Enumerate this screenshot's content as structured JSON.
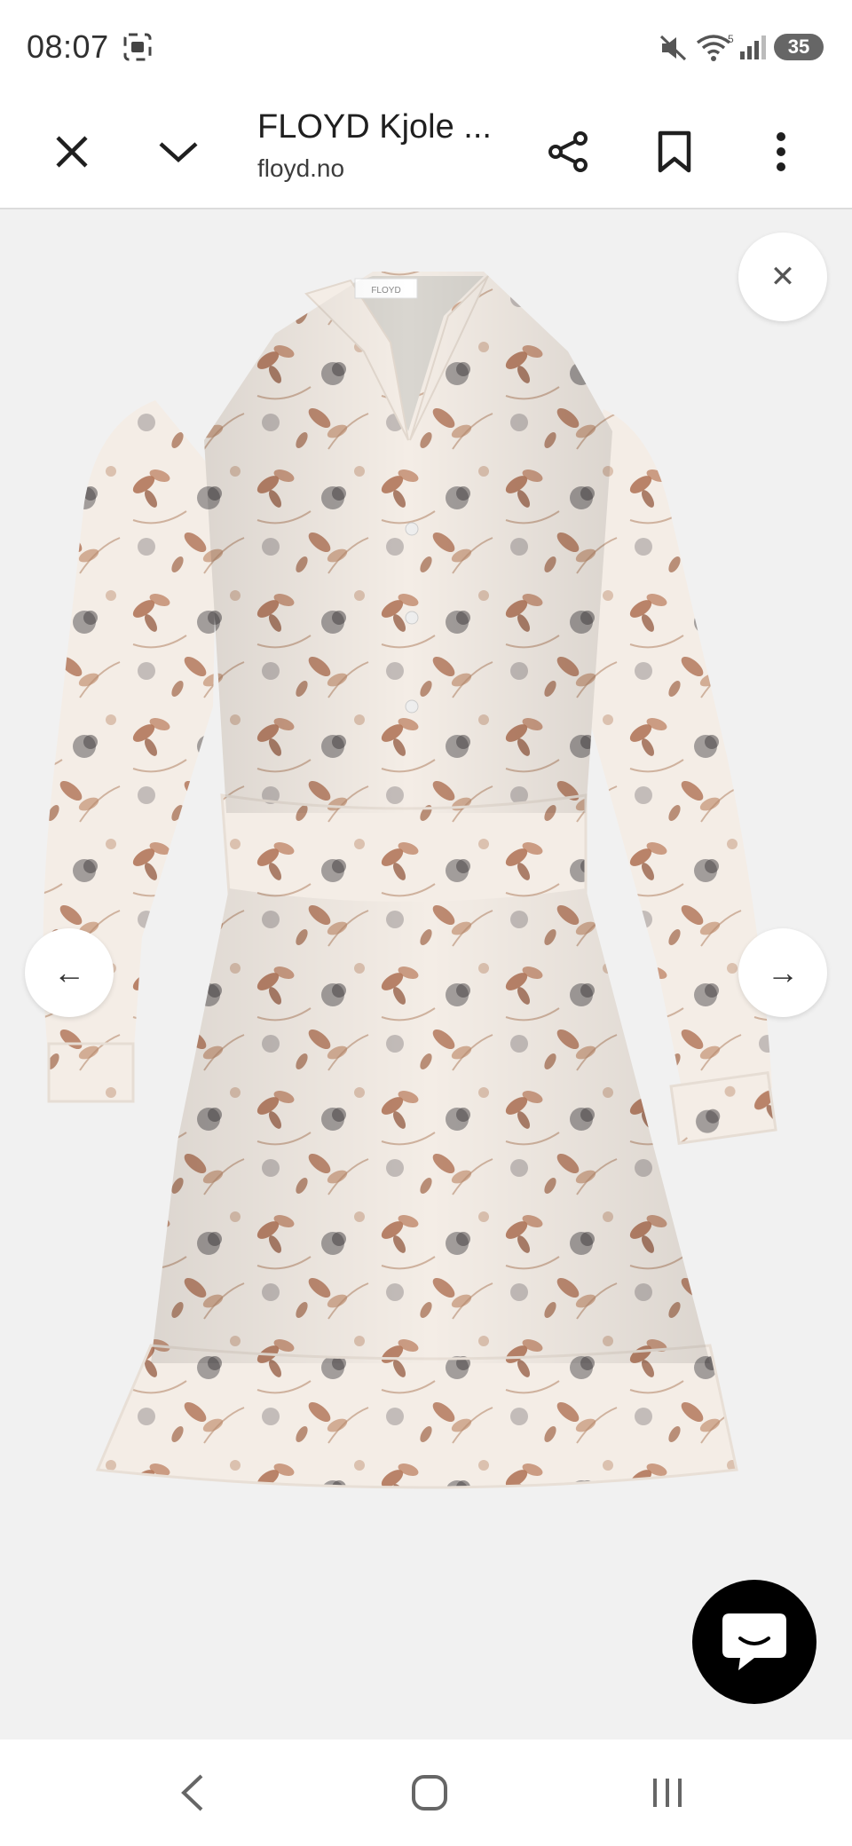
{
  "status_bar": {
    "time": "08:07",
    "battery": "35",
    "icons": [
      "screen-record-icon",
      "mute-icon",
      "wifi-icon",
      "signal-icon",
      "battery-icon"
    ]
  },
  "browser": {
    "title": "FLOYD Kjole ...",
    "url": "floyd.no",
    "icons": [
      "close-icon",
      "chevron-down-icon",
      "share-icon",
      "bookmark-icon",
      "more-vert-icon"
    ]
  },
  "gallery": {
    "close_glyph": "✕",
    "prev_glyph": "←",
    "next_glyph": "→",
    "image_label": "FLOYD"
  },
  "chat": {
    "icon": "chat-bubble-icon"
  },
  "nav": {
    "icons": [
      "back-icon",
      "home-icon",
      "recents-icon"
    ]
  },
  "colors": {
    "background": "#f1f1f1",
    "chat_button": "#000000",
    "dress_base": "#f4ede6",
    "flower_brown": "#9a5a3c",
    "flower_gray": "#5e5a5c"
  }
}
